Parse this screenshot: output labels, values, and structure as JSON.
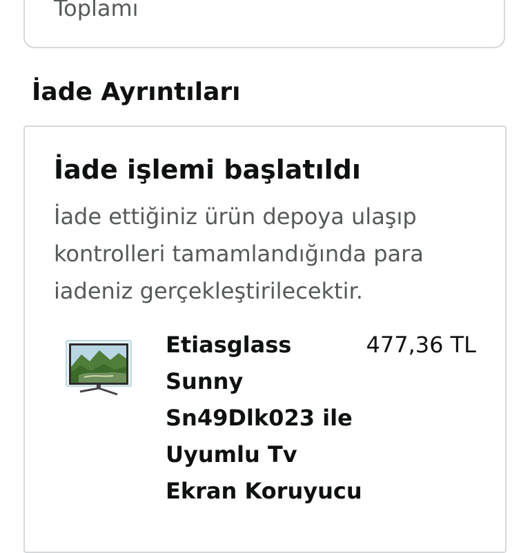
{
  "summary_card": {
    "label": "Toplamı"
  },
  "section": {
    "title": "İade Ayrıntıları"
  },
  "return_card": {
    "status_title": "İade işlemi başlatıldı",
    "status_description": "İade ettiğiniz ürün depoya ulaşıp kontrolleri tamamlandığında para iadeniz gerçekleştirilecektir.",
    "item": {
      "name": "Etiasglass Sunny Sn49Dlk023 ile Uyumlu Tv Ekran Koruyucu",
      "price": "477,36 TL",
      "thumbnail_icon": "tv-screen-protector-thumbnail"
    }
  }
}
